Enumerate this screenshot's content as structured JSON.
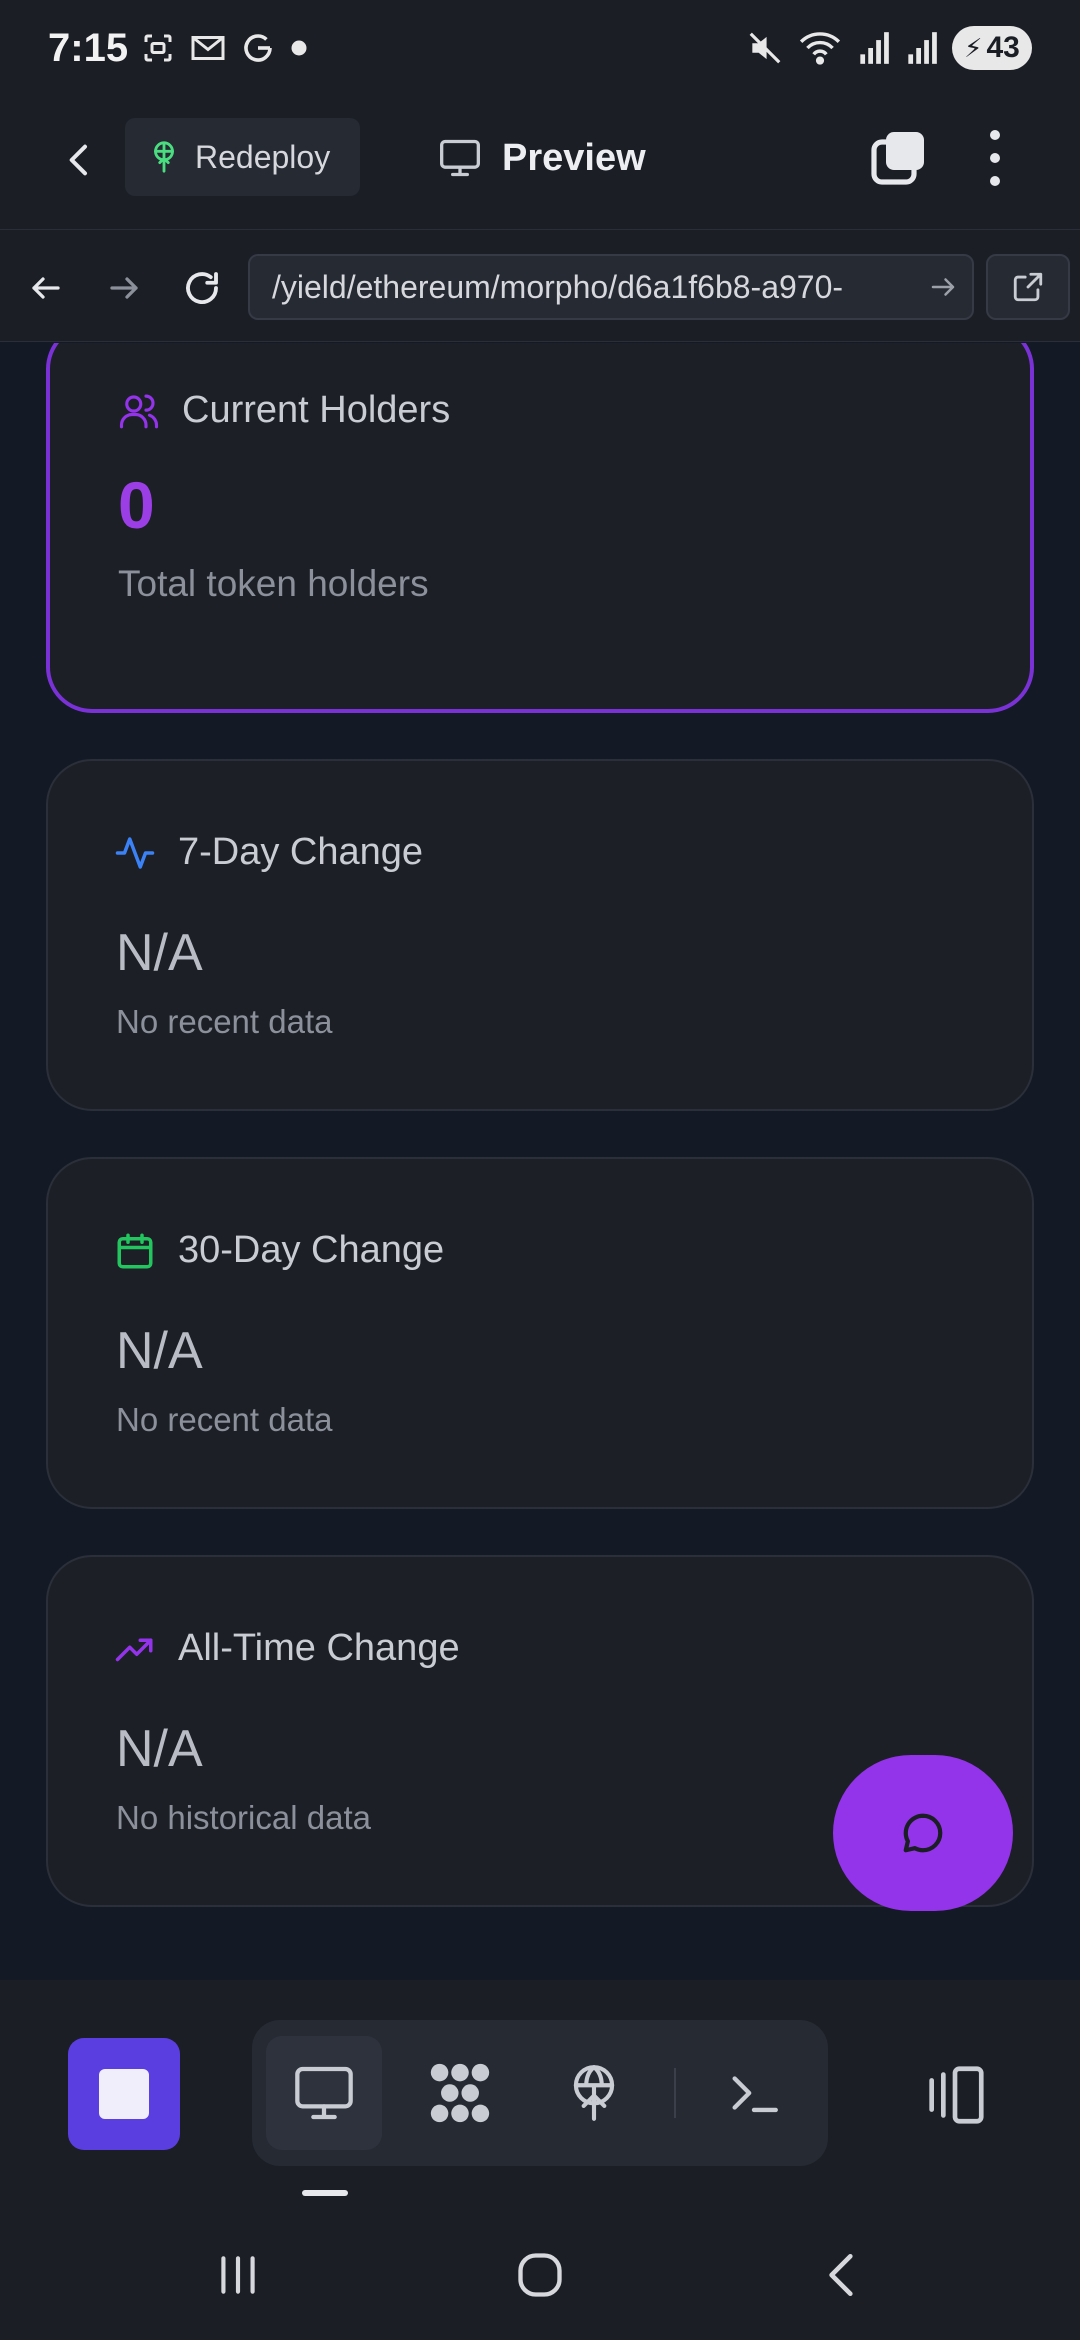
{
  "status_bar": {
    "time": "7:15",
    "battery": "43"
  },
  "app_bar": {
    "redeploy_label": "Redeploy",
    "preview_label": "Preview"
  },
  "browser": {
    "url": "/yield/ethereum/morpho/d6a1f6b8-a970-"
  },
  "cards": [
    {
      "title": "Current Holders",
      "value": "0",
      "subtitle": "Total token holders",
      "icon": "users-icon",
      "accent": "#9333ea"
    },
    {
      "title": "7-Day Change",
      "value": "N/A",
      "subtitle": "No recent data",
      "icon": "activity-icon",
      "accent": "#3b82f6"
    },
    {
      "title": "30-Day Change",
      "value": "N/A",
      "subtitle": "No recent data",
      "icon": "calendar-icon",
      "accent": "#22c55e"
    },
    {
      "title": "All-Time Change",
      "value": "N/A",
      "subtitle": "No historical data",
      "icon": "trending-up-icon",
      "accent": "#9333ea"
    }
  ],
  "colors": {
    "background": "#131925",
    "card": "#1c1f25",
    "highlight_border": "#7a32d6",
    "fab": "#9333ea",
    "stop_button": "#5b3ee0"
  }
}
